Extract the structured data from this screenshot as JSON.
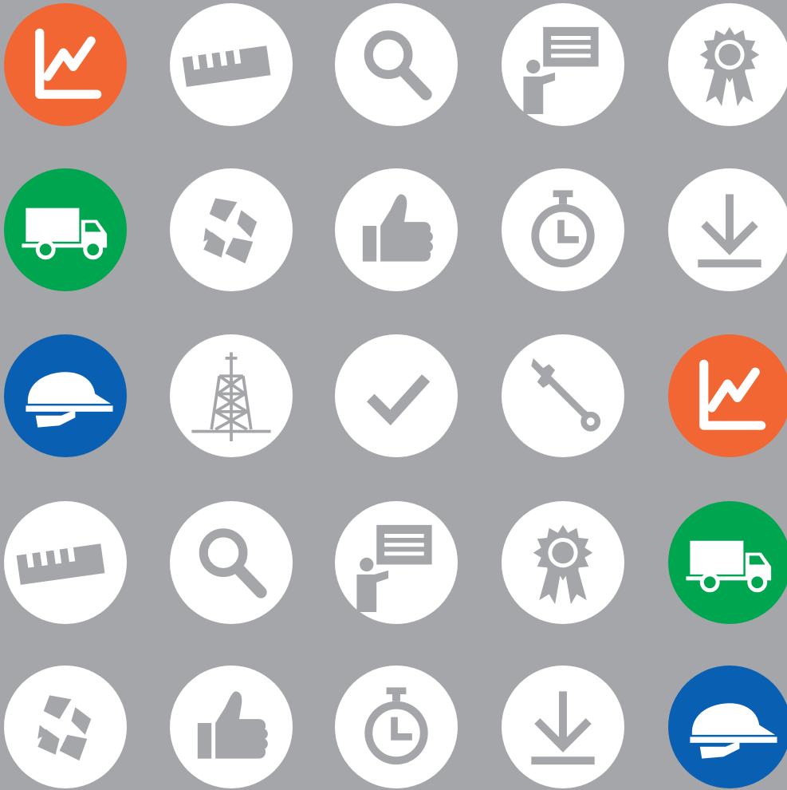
{
  "colors": {
    "background": "#a5a6aa",
    "white": "#ffffff",
    "orange": "#f26634",
    "green": "#00a54f",
    "blue": "#0960b3",
    "glyph_gray": "#a5a6aa"
  },
  "icons": [
    [
      "chart",
      "ruler",
      "search",
      "presentation",
      "award"
    ],
    [
      "truck",
      "recycle",
      "thumbs-up",
      "stopwatch",
      "download"
    ],
    [
      "hard-hat",
      "oil-rig",
      "checkmark",
      "wrench",
      "chart"
    ],
    [
      "ruler",
      "search",
      "presentation",
      "award",
      "truck"
    ],
    [
      "recycle",
      "thumbs-up",
      "stopwatch",
      "download",
      "hard-hat"
    ]
  ]
}
